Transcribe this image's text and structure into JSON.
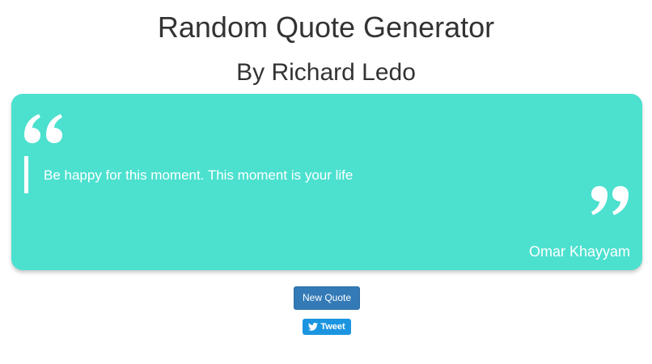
{
  "header": {
    "title": "Random Quote Generator",
    "subtitle": "By Richard Ledo"
  },
  "quote": {
    "text": "Be happy for this moment. This moment is your life",
    "author": "Omar Khayyam"
  },
  "actions": {
    "new_quote_label": "New Quote",
    "tweet_label": "Tweet"
  },
  "icons": {
    "open_quote": "open-quote-icon",
    "close_quote": "close-quote-icon",
    "tweet": "twitter-bird-icon"
  },
  "colors": {
    "card_background": "#4ce0cf",
    "primary_button": "#337ab7",
    "tweet_button": "#1b95e0",
    "heading_text": "#333333",
    "quote_text": "#ffffff"
  }
}
